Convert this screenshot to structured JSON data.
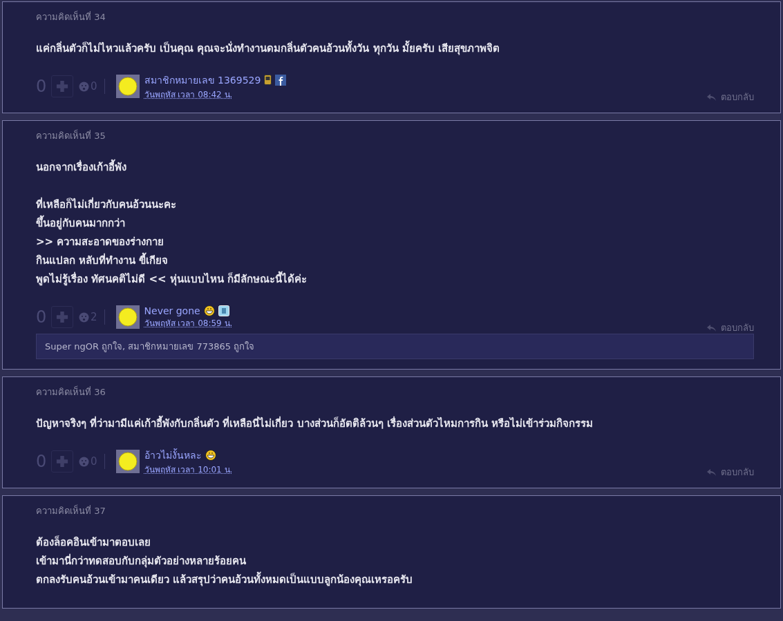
{
  "comments": [
    {
      "number_label": "ความคิดเห็นที่ 34",
      "paragraphs": [
        [
          "แค่กลิ่นตัวก็ไม่ไหวแล้วครับ เป็นคุณ คุณจะนั่งทำงานดมกลิ่นตัวคนอ้วนทั้งวัน ทุกวัน มั้ยครับ เสียสุขภาพจิต"
        ]
      ],
      "footer": {
        "score": "0",
        "emotion_count": "0",
        "author": "สมาชิกหมายเลข 1369529",
        "badges": [
          {
            "kind": "phone"
          },
          {
            "kind": "facebook"
          }
        ],
        "time": "วันพฤหัส เวลา 08:42 น.",
        "reply": "ตอบกลับ"
      }
    },
    {
      "number_label": "ความคิดเห็นที่ 35",
      "paragraphs": [
        [
          "นอกจากเรื่องเก้าอี้พัง"
        ],
        [
          "ที่เหลือก็ไม่เกี่ยวกับคนอ้วนนะคะ",
          "ขึ้นอยู่กับคนมากกว่า",
          ">> ความสะอาดของร่างกาย",
          "กินแปลก หลับที่ทำงาน ขี้เกียจ",
          "พูดไม่รู้เรื่อง ทัศนคติไม่ดี << หุ่นแบบไหน ก็มีลักษณะนี้ได้ค่ะ"
        ]
      ],
      "footer": {
        "score": "0",
        "emotion_count": "2",
        "author": "Never gone",
        "badges": [
          {
            "kind": "grin"
          },
          {
            "kind": "blog"
          }
        ],
        "time": "วันพฤหัส เวลา 08:59 น.",
        "reply": "ตอบกลับ"
      },
      "likes": "Super ngOR ถูกใจ, สมาชิกหมายเลข 773865 ถูกใจ"
    },
    {
      "number_label": "ความคิดเห็นที่ 36",
      "paragraphs": [
        [
          "ปัญหาจริงๆ ที่ว่ามามีแค่เก้าอี้พังกับกลิ่นตัว ที่เหลือนี่ไม่เกี่ยว บางส่วนก็อัตติล้วนๆ เรื่องส่วนตัวไหมการกิน หรือไม่เข้าร่วมกิจกรรม"
        ]
      ],
      "footer": {
        "score": "0",
        "emotion_count": "0",
        "author": "อ้าวไม่งั้นหละ",
        "badges": [
          {
            "kind": "grin"
          }
        ],
        "time": "วันพฤหัส เวลา 10:01 น.",
        "reply": "ตอบกลับ"
      }
    },
    {
      "number_label": "ความคิดเห็นที่ 37",
      "paragraphs": [
        [
          "ต้องล็อคอินเข้ามาตอบเลย",
          "เข้ามานี่กว่าทดสอบกับกลุ่มตัวอย่างหลายร้อยคน",
          "ตกลงรับคนอ้วนเข้ามาคนเดียว แล้วสรุปว่าคนอ้วนทั้งหมดเป็นแบบลูกน้องคุณเหรอครับ"
        ]
      ]
    }
  ]
}
